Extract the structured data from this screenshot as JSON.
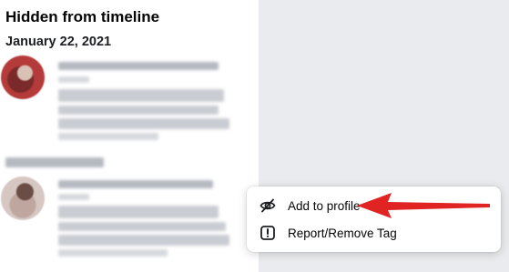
{
  "section": {
    "title": "Hidden from timeline",
    "date": "January 22, 2021"
  },
  "context_menu": {
    "items": [
      {
        "label": "Add to profile",
        "icon": "eye-slash-icon"
      },
      {
        "label": "Report/Remove Tag",
        "icon": "exclamation-box-icon"
      }
    ]
  },
  "colors": {
    "annotation_arrow": "#e02424",
    "menu_background": "#ffffff",
    "page_background": "#e9ebee"
  }
}
